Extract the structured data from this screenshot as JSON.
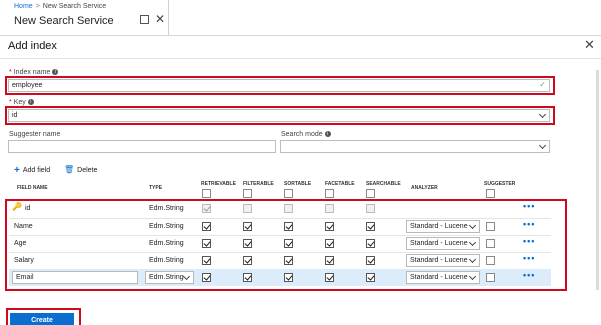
{
  "background": {
    "breadcrumb": [
      "Home",
      "New Search Service"
    ],
    "title": "New Search Service"
  },
  "panel": {
    "title": "Add index"
  },
  "form": {
    "index_name_label": "Index name",
    "index_name_value": "employee",
    "key_label": "Key",
    "key_value": "id",
    "suggester_name_label": "Suggester name",
    "suggester_name_value": "",
    "search_mode_label": "Search mode",
    "search_mode_value": ""
  },
  "toolbar": {
    "add_field": "Add field",
    "delete": "Delete"
  },
  "table": {
    "columns": [
      "FIELD NAME",
      "TYPE",
      "RETRIEVABLE",
      "FILTERABLE",
      "SORTABLE",
      "FACETABLE",
      "SEARCHABLE",
      "ANALYZER",
      "SUGGESTER"
    ],
    "rows": [
      {
        "name": "id",
        "type": "Edm.String",
        "flags": [
          true,
          false,
          false,
          false,
          false
        ],
        "analyzer": "",
        "key": true
      },
      {
        "name": "Name",
        "type": "Edm.String",
        "flags": [
          true,
          true,
          true,
          true,
          true
        ],
        "analyzer": "Standard - Lucene"
      },
      {
        "name": "Age",
        "type": "Edm.String",
        "flags": [
          true,
          true,
          true,
          true,
          true
        ],
        "analyzer": "Standard - Lucene"
      },
      {
        "name": "Salary",
        "type": "Edm.String",
        "flags": [
          true,
          true,
          true,
          true,
          true
        ],
        "analyzer": "Standard - Lucene"
      },
      {
        "name": "Email",
        "type": "Edm.String",
        "flags": [
          true,
          true,
          true,
          true,
          true
        ],
        "analyzer": "Standard - Lucene"
      }
    ],
    "more_label": "•••"
  },
  "actions": {
    "create": "Create"
  },
  "colors": {
    "accent": "#0a6ed1",
    "highlight": "#d00a1e",
    "selected_row": "#dcecfa"
  }
}
